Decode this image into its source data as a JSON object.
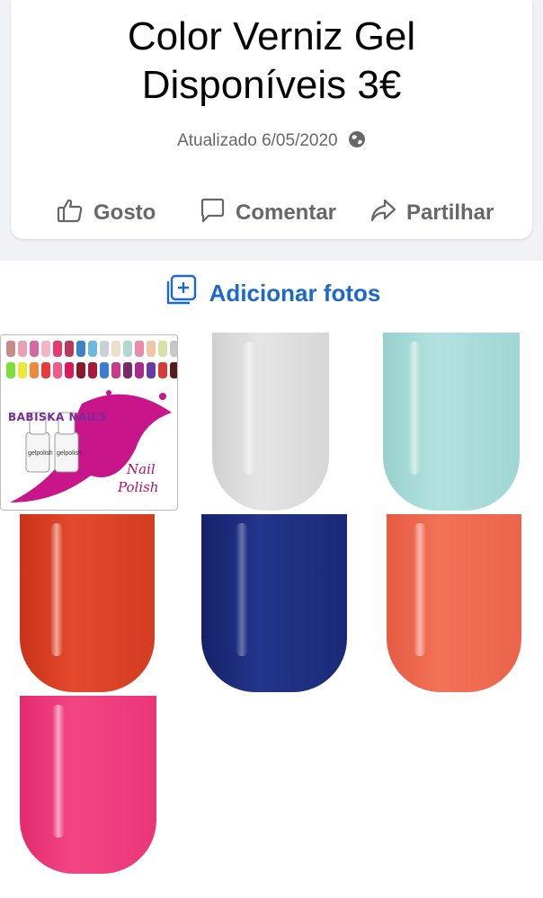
{
  "post": {
    "title_line1": "Color Verniz Gel",
    "title_line2": "Disponíveis 3€",
    "updated": "Atualizado 6/05/2020",
    "visibility_icon": "globe-icon"
  },
  "actions": {
    "like": "Gosto",
    "comment": "Comentar",
    "share": "Partilhar"
  },
  "add_photos": "Adicionar fotos",
  "logo": {
    "brand": "BABISKA NAILS",
    "script_line1": "Nail",
    "script_line2": "Polish",
    "bottle_label": "gelpolish"
  },
  "photos": [
    {
      "name": "logo-collage"
    },
    {
      "name": "color-white",
      "color": "#dcdddc"
    },
    {
      "name": "color-mint",
      "color": "#a7dcd9"
    },
    {
      "name": "color-red-orange",
      "color": "#e0432a"
    },
    {
      "name": "color-navy",
      "color": "#1d2d7e"
    },
    {
      "name": "color-coral",
      "color": "#f06a52"
    },
    {
      "name": "color-pink",
      "color": "#f03d7e"
    }
  ],
  "colors": {
    "accent": "#1b6ac9",
    "muted_text": "#65676b",
    "background": "#f0f2f5"
  }
}
